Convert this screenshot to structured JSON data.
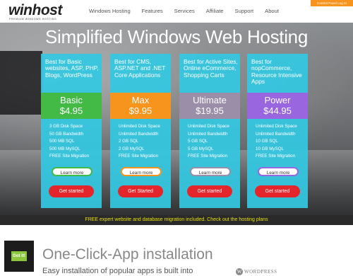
{
  "header": {
    "logo_word": "winhost",
    "logo_tagline": "PREMIUM WINDOWS HOSTING",
    "nav": [
      "Windows Hosting",
      "Features",
      "Services",
      "Affiliate",
      "Support",
      "About"
    ],
    "control_panel_login": "Control Panel Log In"
  },
  "hero": {
    "title": "Simplified Windows Web Hosting"
  },
  "plans": [
    {
      "desc": "Best for Basic websites, ASP, PHP, Blogs, WordPress",
      "name": "Basic",
      "price": "$4.95",
      "band_color": "#43b946",
      "features": [
        "3 GB Disk Space",
        "50 GB Bandwidth",
        "500 MB SQL",
        "500 MB MySQL",
        "FREE Site Migration"
      ],
      "learn_label": "Learn more",
      "learn_color": "#43b946",
      "start_label": "Get started"
    },
    {
      "desc": "Best for CMS, ASP.NET and .NET Core Applications",
      "name": "Max",
      "price": "$9.95",
      "band_color": "#f7941d",
      "features": [
        "Unlimited Disk Space",
        "Unlimited Bandwidth",
        "2 GB SQL",
        "2 GB MySQL",
        "FREE Site Migration"
      ],
      "learn_label": "Learn more",
      "learn_color": "#f7941d",
      "start_label": "Get Started"
    },
    {
      "desc": "Best for Active Sites, Online eCommerce, Shopping Carts",
      "name": "Ultimate",
      "price": "$19.95",
      "band_color": "#9b8ea8",
      "features": [
        "Unlimited Disk Space",
        "Unlimited Bandwidth",
        "5 GB SQL",
        "5 GB MySQL",
        "FREE Site Migration"
      ],
      "learn_label": "Learn more",
      "learn_color": "#9b8ea8",
      "start_label": "Get started"
    },
    {
      "desc": "Best for nopCommerce, Resource Intensive Apps",
      "name": "Power",
      "price": "$44.95",
      "band_color": "#9966e0",
      "features": [
        "Unlimited Disk Space",
        "Unlimited Bandwidth",
        "10 GB SQL",
        "10 GB MySQL",
        "FREE Site Migration"
      ],
      "learn_label": "Learn more",
      "learn_color": "#9966e0",
      "start_label": "Get started"
    }
  ],
  "promo": "FREE expert website and database migration included. Check out the hosting plans",
  "one_click": {
    "title": "One-Click-App installation",
    "subtitle": "Easy installation of popular apps is built into",
    "wordpress_label": "WORDPRESS"
  },
  "cookie": {
    "button": "Got it!"
  },
  "colors": {
    "accent_orange": "#f7941d",
    "card_cyan": "#34c8e2",
    "cta_red": "#e4262c",
    "promo_yellow": "#e8e000"
  }
}
